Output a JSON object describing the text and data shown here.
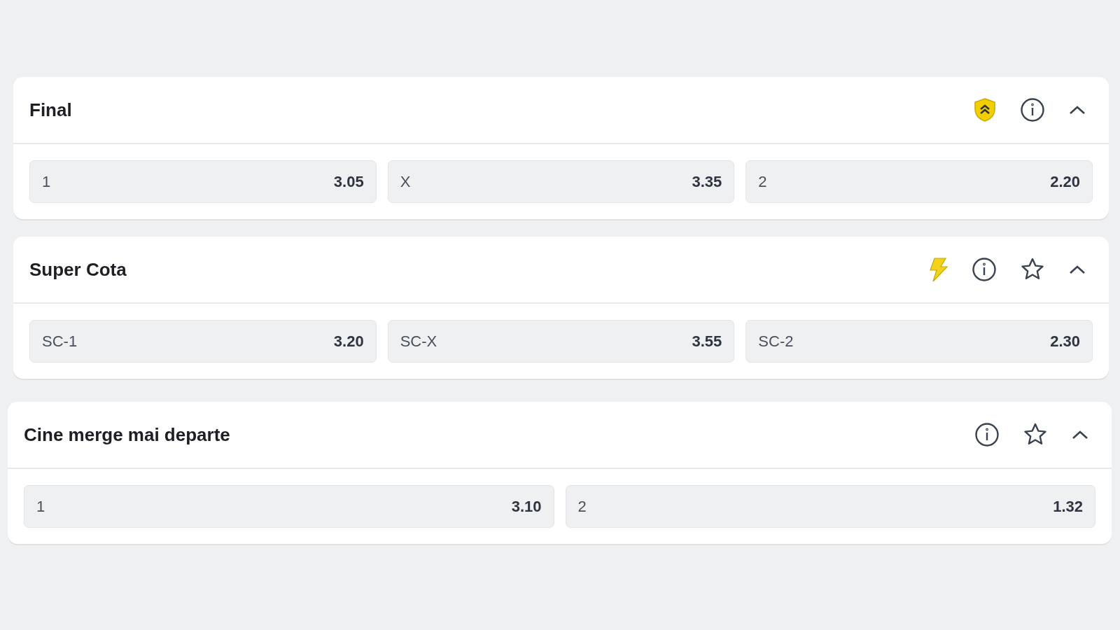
{
  "markets": [
    {
      "title": "Final",
      "icons": [
        {
          "kind": "shield"
        },
        {
          "kind": "info"
        },
        {
          "kind": "chevron"
        }
      ],
      "odds": [
        {
          "label": "1",
          "value": "3.05"
        },
        {
          "label": "X",
          "value": "3.35"
        },
        {
          "label": "2",
          "value": "2.20"
        }
      ]
    },
    {
      "title": "Super Cota",
      "icons": [
        {
          "kind": "bolt"
        },
        {
          "kind": "info"
        },
        {
          "kind": "star"
        },
        {
          "kind": "chevron"
        }
      ],
      "odds": [
        {
          "label": "SC-1",
          "value": "3.20"
        },
        {
          "label": "SC-X",
          "value": "3.55"
        },
        {
          "label": "SC-2",
          "value": "2.30"
        }
      ]
    },
    {
      "title": "Cine merge mai departe",
      "icons": [
        {
          "kind": "info"
        },
        {
          "kind": "star"
        },
        {
          "kind": "chevron"
        }
      ],
      "odds": [
        {
          "label": "1",
          "value": "3.10"
        },
        {
          "label": "2",
          "value": "1.32"
        }
      ]
    }
  ]
}
